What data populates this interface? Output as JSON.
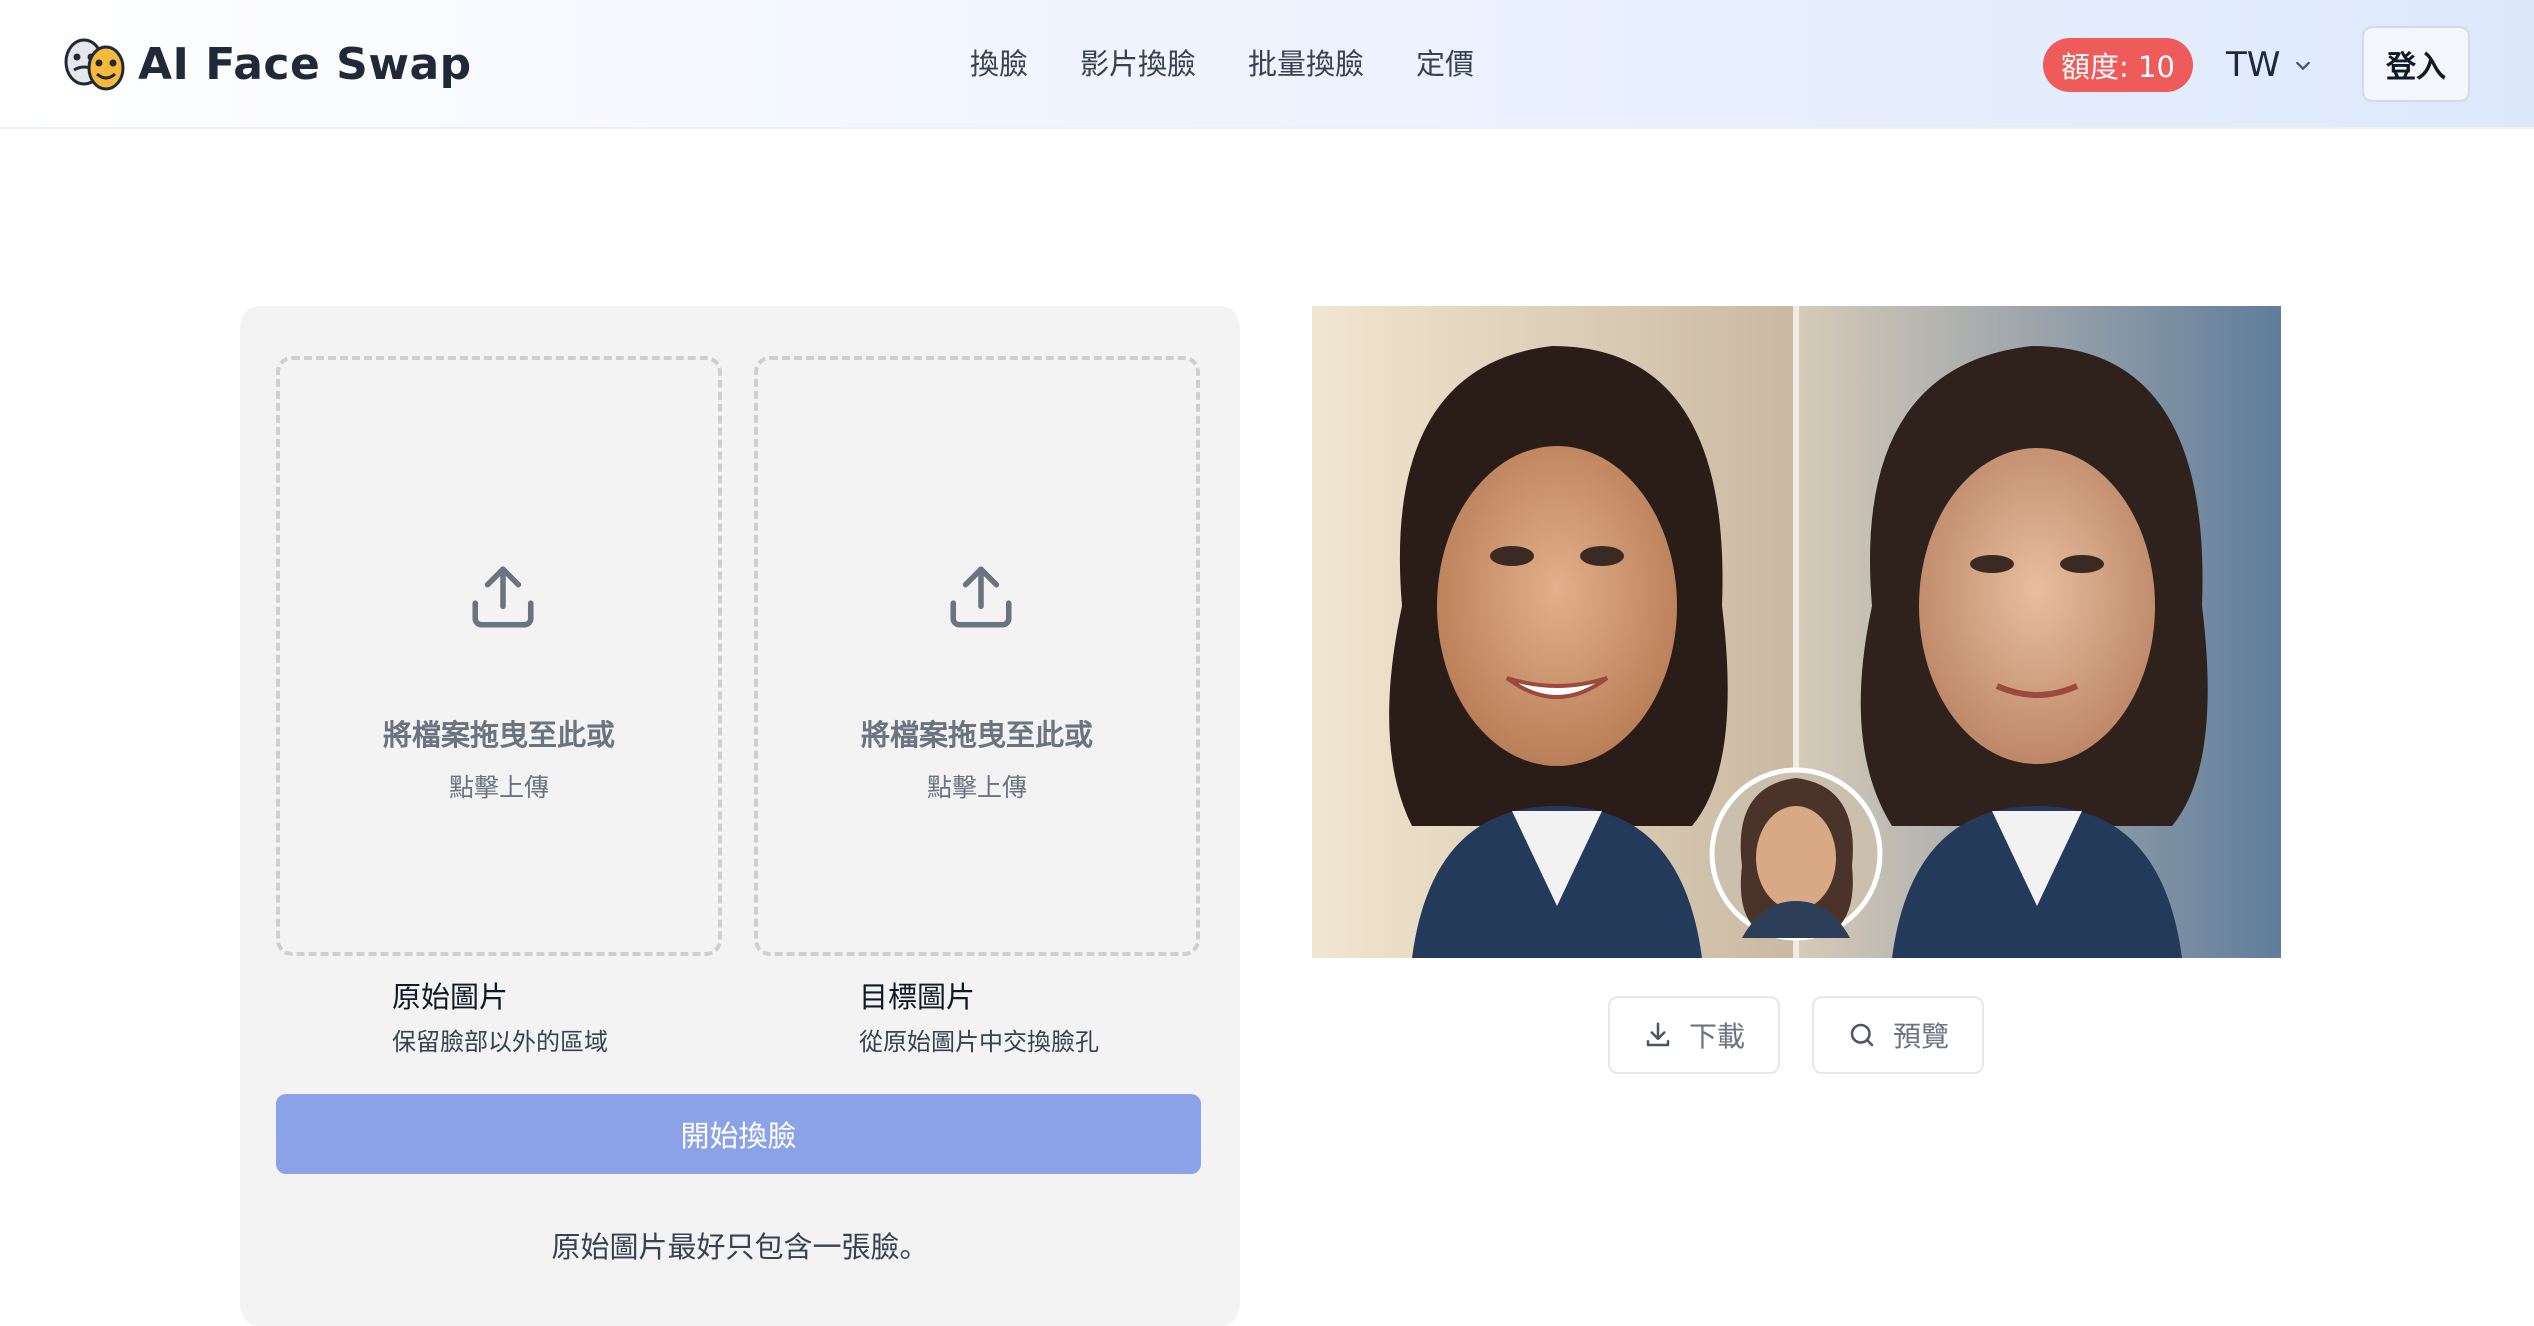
{
  "app": {
    "title": "AI Face Swap"
  },
  "nav": {
    "items": [
      "換臉",
      "影片換臉",
      "批量換臉",
      "定價"
    ]
  },
  "header": {
    "credits_label": "額度: 10",
    "language": "TW",
    "login_label": "登入"
  },
  "upload": {
    "source": {
      "drop_text": "將檔案拖曳至此或",
      "click_text": "點擊上傳",
      "label": "原始圖片",
      "description": "保留臉部以外的區域"
    },
    "target": {
      "drop_text": "將檔案拖曳至此或",
      "click_text": "點擊上傳",
      "label": "目標圖片",
      "description": "從原始圖片中交換臉孔"
    },
    "start_button": "開始換臉",
    "tip": "原始圖片最好只包含一張臉。"
  },
  "preview": {
    "download_label": "下載",
    "preview_label": "預覽"
  },
  "colors": {
    "accent": "#8ba2e6",
    "badge": "#ef5a5a"
  },
  "icons": [
    "logo-masks-icon",
    "chevron-down-icon",
    "upload-icon",
    "download-icon",
    "search-icon"
  ]
}
